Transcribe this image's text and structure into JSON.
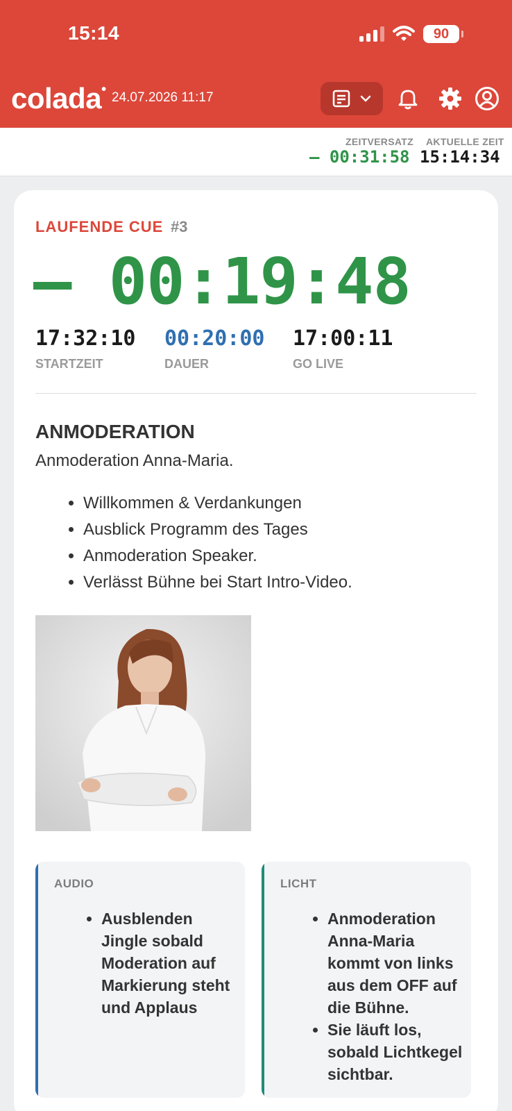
{
  "status_bar": {
    "time": "15:14",
    "battery": "90"
  },
  "header": {
    "logo": "colada",
    "date": "24.07.2026 11:17",
    "icons": [
      "list-icon",
      "chevron-down-icon",
      "bell-icon",
      "gear-icon",
      "user-icon"
    ],
    "color": "#dc473a"
  },
  "timebar": {
    "offset_label": "ZEITVERSATZ",
    "offset_value": "– 00:31:58",
    "current_label": "AKTUELLE ZEIT",
    "current_value": "15:14:34"
  },
  "cue": {
    "label": "LAUFENDE CUE",
    "number": "#3",
    "timer": "– 00:19:48",
    "start_value": "17:32:10",
    "start_label": "STARTZEIT",
    "duration_value": "00:20:00",
    "duration_label": "DAUER",
    "golive_value": "17:00:11",
    "golive_label": "GO LIVE",
    "timer_color": "#2f9448",
    "duration_color": "#2f6fb0"
  },
  "content": {
    "title": "ANMODERATION",
    "subtitle": "Anmoderation Anna-Maria.",
    "bullets": [
      "Willkommen & Verdankungen",
      "Ausblick Programm des Tages",
      "Anmoderation Speaker.",
      "Verlässt Bühne bei Start Intro-Video."
    ]
  },
  "notes": {
    "audio": {
      "label": "AUDIO",
      "items": [
        "Ausblenden Jingle sobald Moderation auf Markierung steht und Applaus"
      ],
      "color": "#2f6fb0"
    },
    "licht": {
      "label": "LICHT",
      "items": [
        "Anmoderation Anna-Maria kommt von links aus dem OFF auf die Bühne.",
        "Sie läuft los, sobald Lichtkegel sichtbar."
      ],
      "color": "#1f8a7a"
    }
  }
}
